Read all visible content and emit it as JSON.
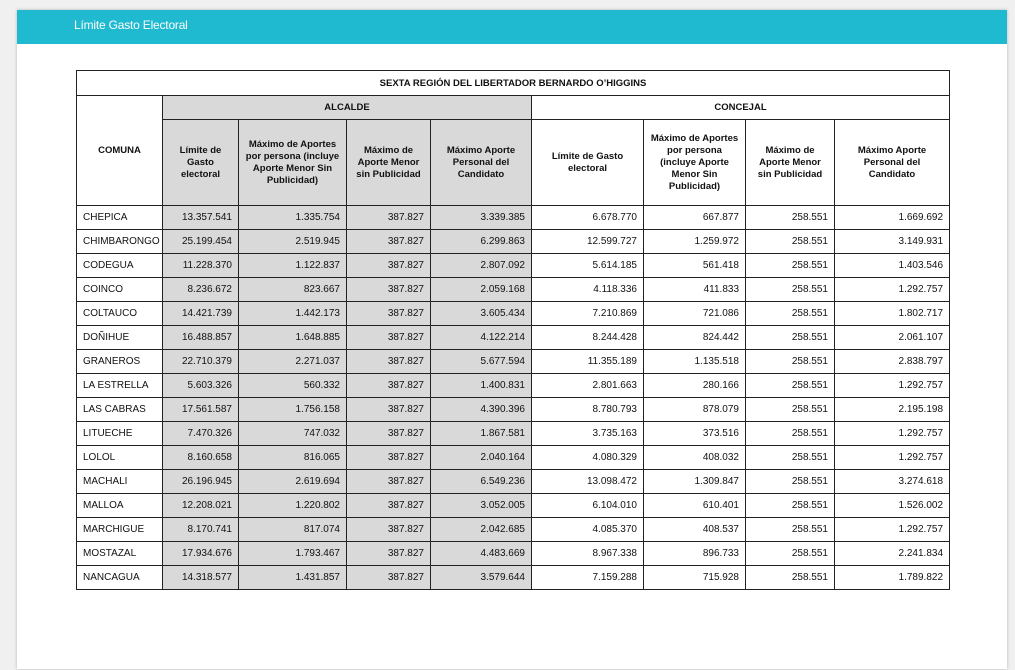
{
  "header": {
    "title": "Límite Gasto Electoral"
  },
  "table": {
    "title": "SEXTA REGIÓN DEL LIBERTADOR BERNARDO O’HIGGINS",
    "comuna_label": "COMUNA",
    "groups": [
      "ALCALDE",
      "CONCEJAL"
    ],
    "alcalde_headers": [
      "Límite de Gasto electoral",
      "Máximo de Aportes por persona (incluye Aporte Menor Sin Publicidad)",
      "Máximo de Aporte Menor sin Publicidad",
      "Máximo Aporte Personal del Candidato"
    ],
    "concejal_headers": [
      "Límite de Gasto electoral",
      "Máximo de Aportes por persona (incluye Aporte Menor Sin Publicidad)",
      "Máximo de Aporte Menor sin Publicidad",
      "Máximo Aporte Personal del Candidato"
    ],
    "rows": [
      [
        "CHEPICA",
        "13.357.541",
        "1.335.754",
        "387.827",
        "3.339.385",
        "6.678.770",
        "667.877",
        "258.551",
        "1.669.692"
      ],
      [
        "CHIMBARONGO",
        "25.199.454",
        "2.519.945",
        "387.827",
        "6.299.863",
        "12.599.727",
        "1.259.972",
        "258.551",
        "3.149.931"
      ],
      [
        "CODEGUA",
        "11.228.370",
        "1.122.837",
        "387.827",
        "2.807.092",
        "5.614.185",
        "561.418",
        "258.551",
        "1.403.546"
      ],
      [
        "COINCO",
        "8.236.672",
        "823.667",
        "387.827",
        "2.059.168",
        "4.118.336",
        "411.833",
        "258.551",
        "1.292.757"
      ],
      [
        "COLTAUCO",
        "14.421.739",
        "1.442.173",
        "387.827",
        "3.605.434",
        "7.210.869",
        "721.086",
        "258.551",
        "1.802.717"
      ],
      [
        "DOÑIHUE",
        "16.488.857",
        "1.648.885",
        "387.827",
        "4.122.214",
        "8.244.428",
        "824.442",
        "258.551",
        "2.061.107"
      ],
      [
        "GRANEROS",
        "22.710.379",
        "2.271.037",
        "387.827",
        "5.677.594",
        "11.355.189",
        "1.135.518",
        "258.551",
        "2.838.797"
      ],
      [
        "LA ESTRELLA",
        "5.603.326",
        "560.332",
        "387.827",
        "1.400.831",
        "2.801.663",
        "280.166",
        "258.551",
        "1.292.757"
      ],
      [
        "LAS CABRAS",
        "17.561.587",
        "1.756.158",
        "387.827",
        "4.390.396",
        "8.780.793",
        "878.079",
        "258.551",
        "2.195.198"
      ],
      [
        "LITUECHE",
        "7.470.326",
        "747.032",
        "387.827",
        "1.867.581",
        "3.735.163",
        "373.516",
        "258.551",
        "1.292.757"
      ],
      [
        "LOLOL",
        "8.160.658",
        "816.065",
        "387.827",
        "2.040.164",
        "4.080.329",
        "408.032",
        "258.551",
        "1.292.757"
      ],
      [
        "MACHALI",
        "26.196.945",
        "2.619.694",
        "387.827",
        "6.549.236",
        "13.098.472",
        "1.309.847",
        "258.551",
        "3.274.618"
      ],
      [
        "MALLOA",
        "12.208.021",
        "1.220.802",
        "387.827",
        "3.052.005",
        "6.104.010",
        "610.401",
        "258.551",
        "1.526.002"
      ],
      [
        "MARCHIGUE",
        "8.170.741",
        "817.074",
        "387.827",
        "2.042.685",
        "4.085.370",
        "408.537",
        "258.551",
        "1.292.757"
      ],
      [
        "MOSTAZAL",
        "17.934.676",
        "1.793.467",
        "387.827",
        "4.483.669",
        "8.967.338",
        "896.733",
        "258.551",
        "2.241.834"
      ],
      [
        "NANCAGUA",
        "14.318.577",
        "1.431.857",
        "387.827",
        "3.579.644",
        "7.159.288",
        "715.928",
        "258.551",
        "1.789.822"
      ]
    ]
  },
  "colors": {
    "topbar": "#1fbad0",
    "shade": "#d9d9d9"
  }
}
